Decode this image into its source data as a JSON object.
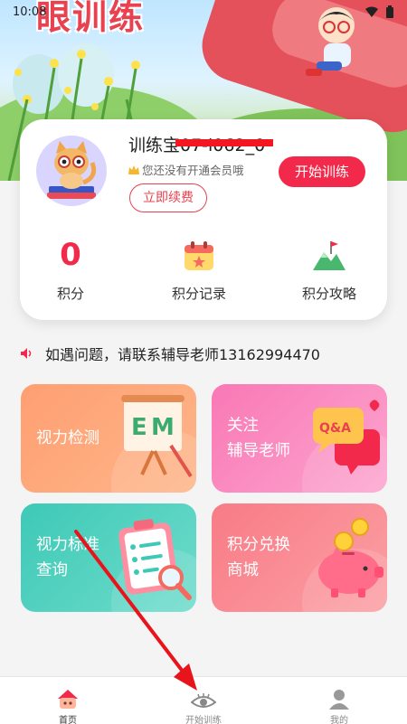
{
  "status_bar": {
    "time": "10:08"
  },
  "hero": {
    "title": "眼训练"
  },
  "profile": {
    "username": "训练宝07-l062_0",
    "member_note": "您还没有开通会员哦",
    "renew_label": "立即续费",
    "start_training_label": "开始训练",
    "stats": [
      {
        "value": "0",
        "label": "积分"
      },
      {
        "icon": "calendar-icon",
        "label": "积分记录"
      },
      {
        "icon": "mountain-flag-icon",
        "label": "积分攻略"
      }
    ]
  },
  "notice": {
    "icon": "speaker-icon",
    "text": "如遇问题，请联系辅导老师13162994470"
  },
  "tiles": [
    {
      "lines": [
        "视力检测"
      ],
      "icon": "eye-chart-icon",
      "color": "#ff9f72"
    },
    {
      "lines": [
        "关注",
        "辅导老师"
      ],
      "icon": "qa-bubble-icon",
      "color": "#f978b5"
    },
    {
      "lines": [
        "视力标准",
        "查询"
      ],
      "icon": "clipboard-search-icon",
      "color": "#3ec9b6"
    },
    {
      "lines": [
        "积分兑换",
        "商城"
      ],
      "icon": "piggy-bank-icon",
      "color": "#f87b86"
    }
  ],
  "tabbar": {
    "tabs": [
      {
        "label": "首页",
        "icon": "home-icon",
        "active": true
      },
      {
        "label": "开始训练",
        "icon": "eye-icon",
        "active": false
      },
      {
        "label": "我的",
        "icon": "user-icon",
        "active": false
      }
    ]
  },
  "colors": {
    "accent": "#f2294a",
    "annotation_arrow": "#e8141c"
  }
}
